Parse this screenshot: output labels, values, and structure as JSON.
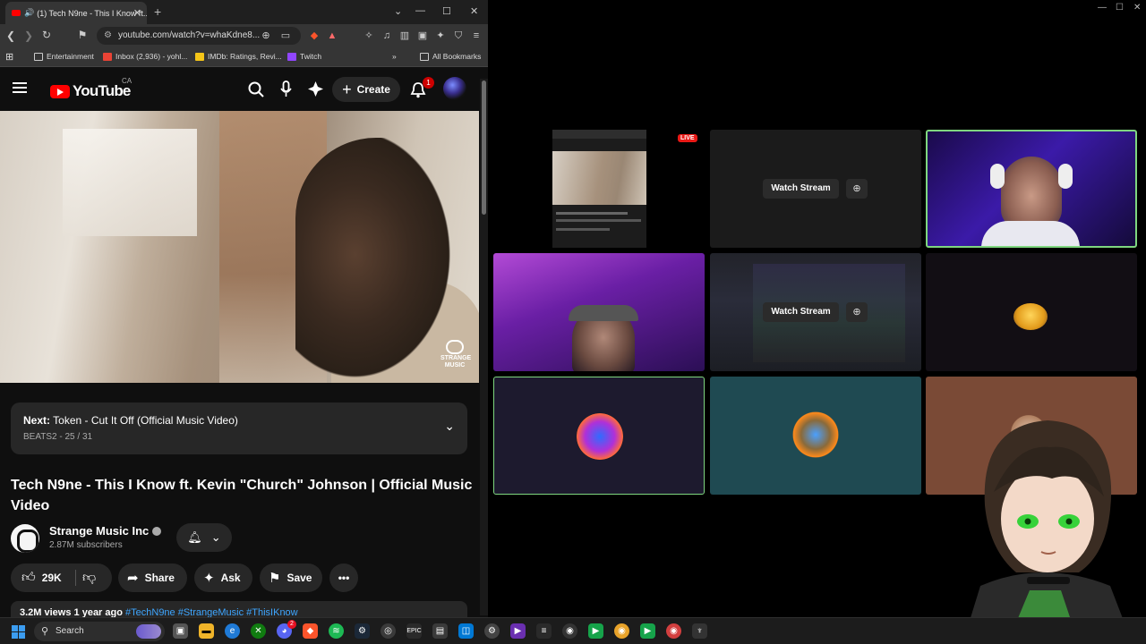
{
  "browser": {
    "tab_title": "(1) Tech N9ne - This I Know ft...",
    "url": "youtube.com/watch?v=whaKdne8...",
    "bookmarks": [
      {
        "label": "Entertainment",
        "icon": "folder-icon"
      },
      {
        "label": "Inbox (2,936) - yohl...",
        "icon": "gmail-icon"
      },
      {
        "label": "IMDb: Ratings, Revi...",
        "icon": "imdb-icon"
      },
      {
        "label": "Twitch",
        "icon": "twitch-icon"
      }
    ],
    "more_bookmarks": "»",
    "all_bookmarks": "All Bookmarks"
  },
  "youtube": {
    "logo": "YouTube",
    "region": "CA",
    "create_label": "Create",
    "notification_count": "1",
    "up_next": {
      "prefix": "Next:",
      "title": "Token - Cut It Off (Official Music Video)",
      "playlist": "BEATS2 - 25 / 31"
    },
    "video_title": "Tech N9ne - This I Know ft. Kevin \"Church\" Johnson | Official Music Video",
    "video_watermark": "STRANGE MUSIC",
    "channel": {
      "name": "Strange Music Inc",
      "subscribers": "2.87M subscribers"
    },
    "actions": {
      "likes": "29K",
      "share": "Share",
      "ask": "Ask",
      "save": "Save"
    },
    "description_preview": {
      "stats": "3.2M views  1 year ago",
      "tags": "#TechN9ne #StrangeMusic #ThisIKnow"
    }
  },
  "multistream": {
    "live_badge": "LIVE",
    "watch_stream_label": "Watch Stream"
  },
  "taskbar": {
    "search_label": "Search",
    "badges": {
      "discord": "2"
    }
  },
  "colors": {
    "youtube_red": "#ff0000",
    "live_red": "#e91916",
    "active_tile_border": "#7fd67f",
    "teal_tile": "#1f4a52",
    "brown_tile": "#7a4a36"
  }
}
